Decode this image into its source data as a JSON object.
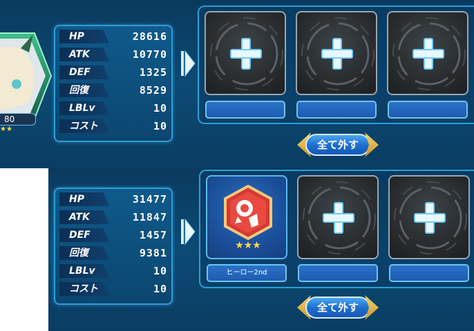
{
  "top_unit": {
    "level": "80",
    "stats": [
      {
        "label": "HP",
        "value": "28616"
      },
      {
        "label": "ATK",
        "value": "10770"
      },
      {
        "label": "DEF",
        "value": "1325"
      },
      {
        "label": "回復",
        "value": "8529"
      },
      {
        "label": "LBLv",
        "value": "10"
      },
      {
        "label": "コスト",
        "value": "10"
      }
    ],
    "slots": [
      {
        "state": "empty",
        "icon": "plus-icon",
        "label": ""
      },
      {
        "state": "empty",
        "icon": "plus-icon",
        "label": ""
      },
      {
        "state": "empty",
        "icon": "plus-icon",
        "label": ""
      }
    ],
    "remove_all_label": "全て外す"
  },
  "bottom_unit": {
    "stats": [
      {
        "label": "HP",
        "value": "31477"
      },
      {
        "label": "ATK",
        "value": "11847"
      },
      {
        "label": "DEF",
        "value": "1457"
      },
      {
        "label": "回復",
        "value": "9381"
      },
      {
        "label": "LBLv",
        "value": "10"
      },
      {
        "label": "コスト",
        "value": "10"
      }
    ],
    "slots": [
      {
        "state": "equipped",
        "icon": "hero-emblem-icon",
        "rarity_stars": 3,
        "label": "ヒーロー2nd"
      },
      {
        "state": "empty",
        "icon": "plus-icon",
        "label": ""
      },
      {
        "state": "empty",
        "icon": "plus-icon",
        "label": ""
      }
    ],
    "remove_all_label": "全て外す"
  },
  "colors": {
    "panel_bg": "#0c4a74",
    "accent_border": "#2a9fd8",
    "slot_label_bg": "#1e5bb0",
    "button_gold": "#f5d76e",
    "plus_glow": "#bfe9ff",
    "star": "#ffd84a"
  }
}
